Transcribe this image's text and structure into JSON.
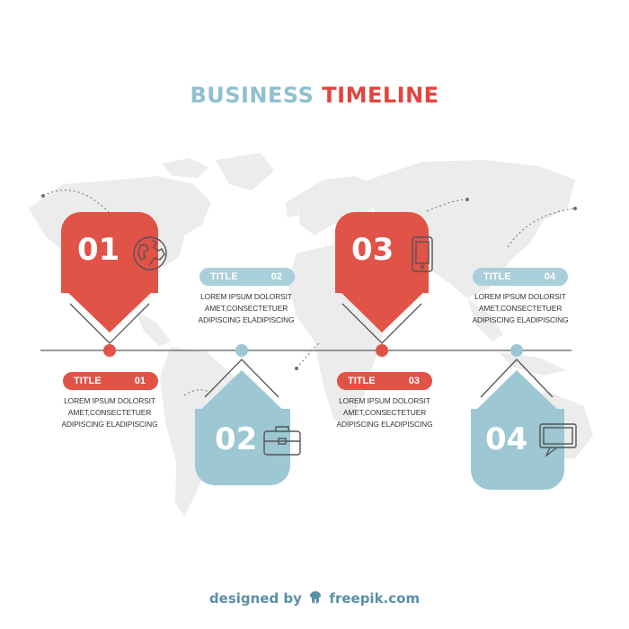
{
  "title": {
    "word1": "BUSINESS",
    "word2": "TIMELINE"
  },
  "colors": {
    "red": "#e15247",
    "blue": "#9cc7d3",
    "line": "#777777",
    "map": "#ebebeb"
  },
  "steps": [
    {
      "number": "01",
      "icon": "globe-icon",
      "color": "red",
      "title": "TITLE",
      "title_num": "01",
      "text": [
        "LOREM IPSUM DOLORSIT",
        "AMET,CONSECTETUER",
        "ADIPISCING ELADIPISCING"
      ]
    },
    {
      "number": "02",
      "icon": "briefcase-icon",
      "color": "blue",
      "title": "TITLE",
      "title_num": "02",
      "text": [
        "LOREM IPSUM DOLORSIT",
        "AMET,CONSECTETUER",
        "ADIPISCING ELADIPISCING"
      ]
    },
    {
      "number": "03",
      "icon": "tablet-icon",
      "color": "red",
      "title": "TITLE",
      "title_num": "03",
      "text": [
        "LOREM IPSUM DOLORSIT",
        "AMET,CONSECTETUER",
        "ADIPISCING ELADIPISCING"
      ]
    },
    {
      "number": "04",
      "icon": "chat-bubble-icon",
      "color": "blue",
      "title": "TITLE",
      "title_num": "04",
      "text": [
        "LOREM IPSUM DOLORSIT",
        "AMET,CONSECTETUER",
        "ADIPISCING ELADIPISCING"
      ]
    }
  ],
  "footer": {
    "prefix": "designed by",
    "brand": "freepik.com",
    "logo_icon": "freepik-logo-icon"
  }
}
